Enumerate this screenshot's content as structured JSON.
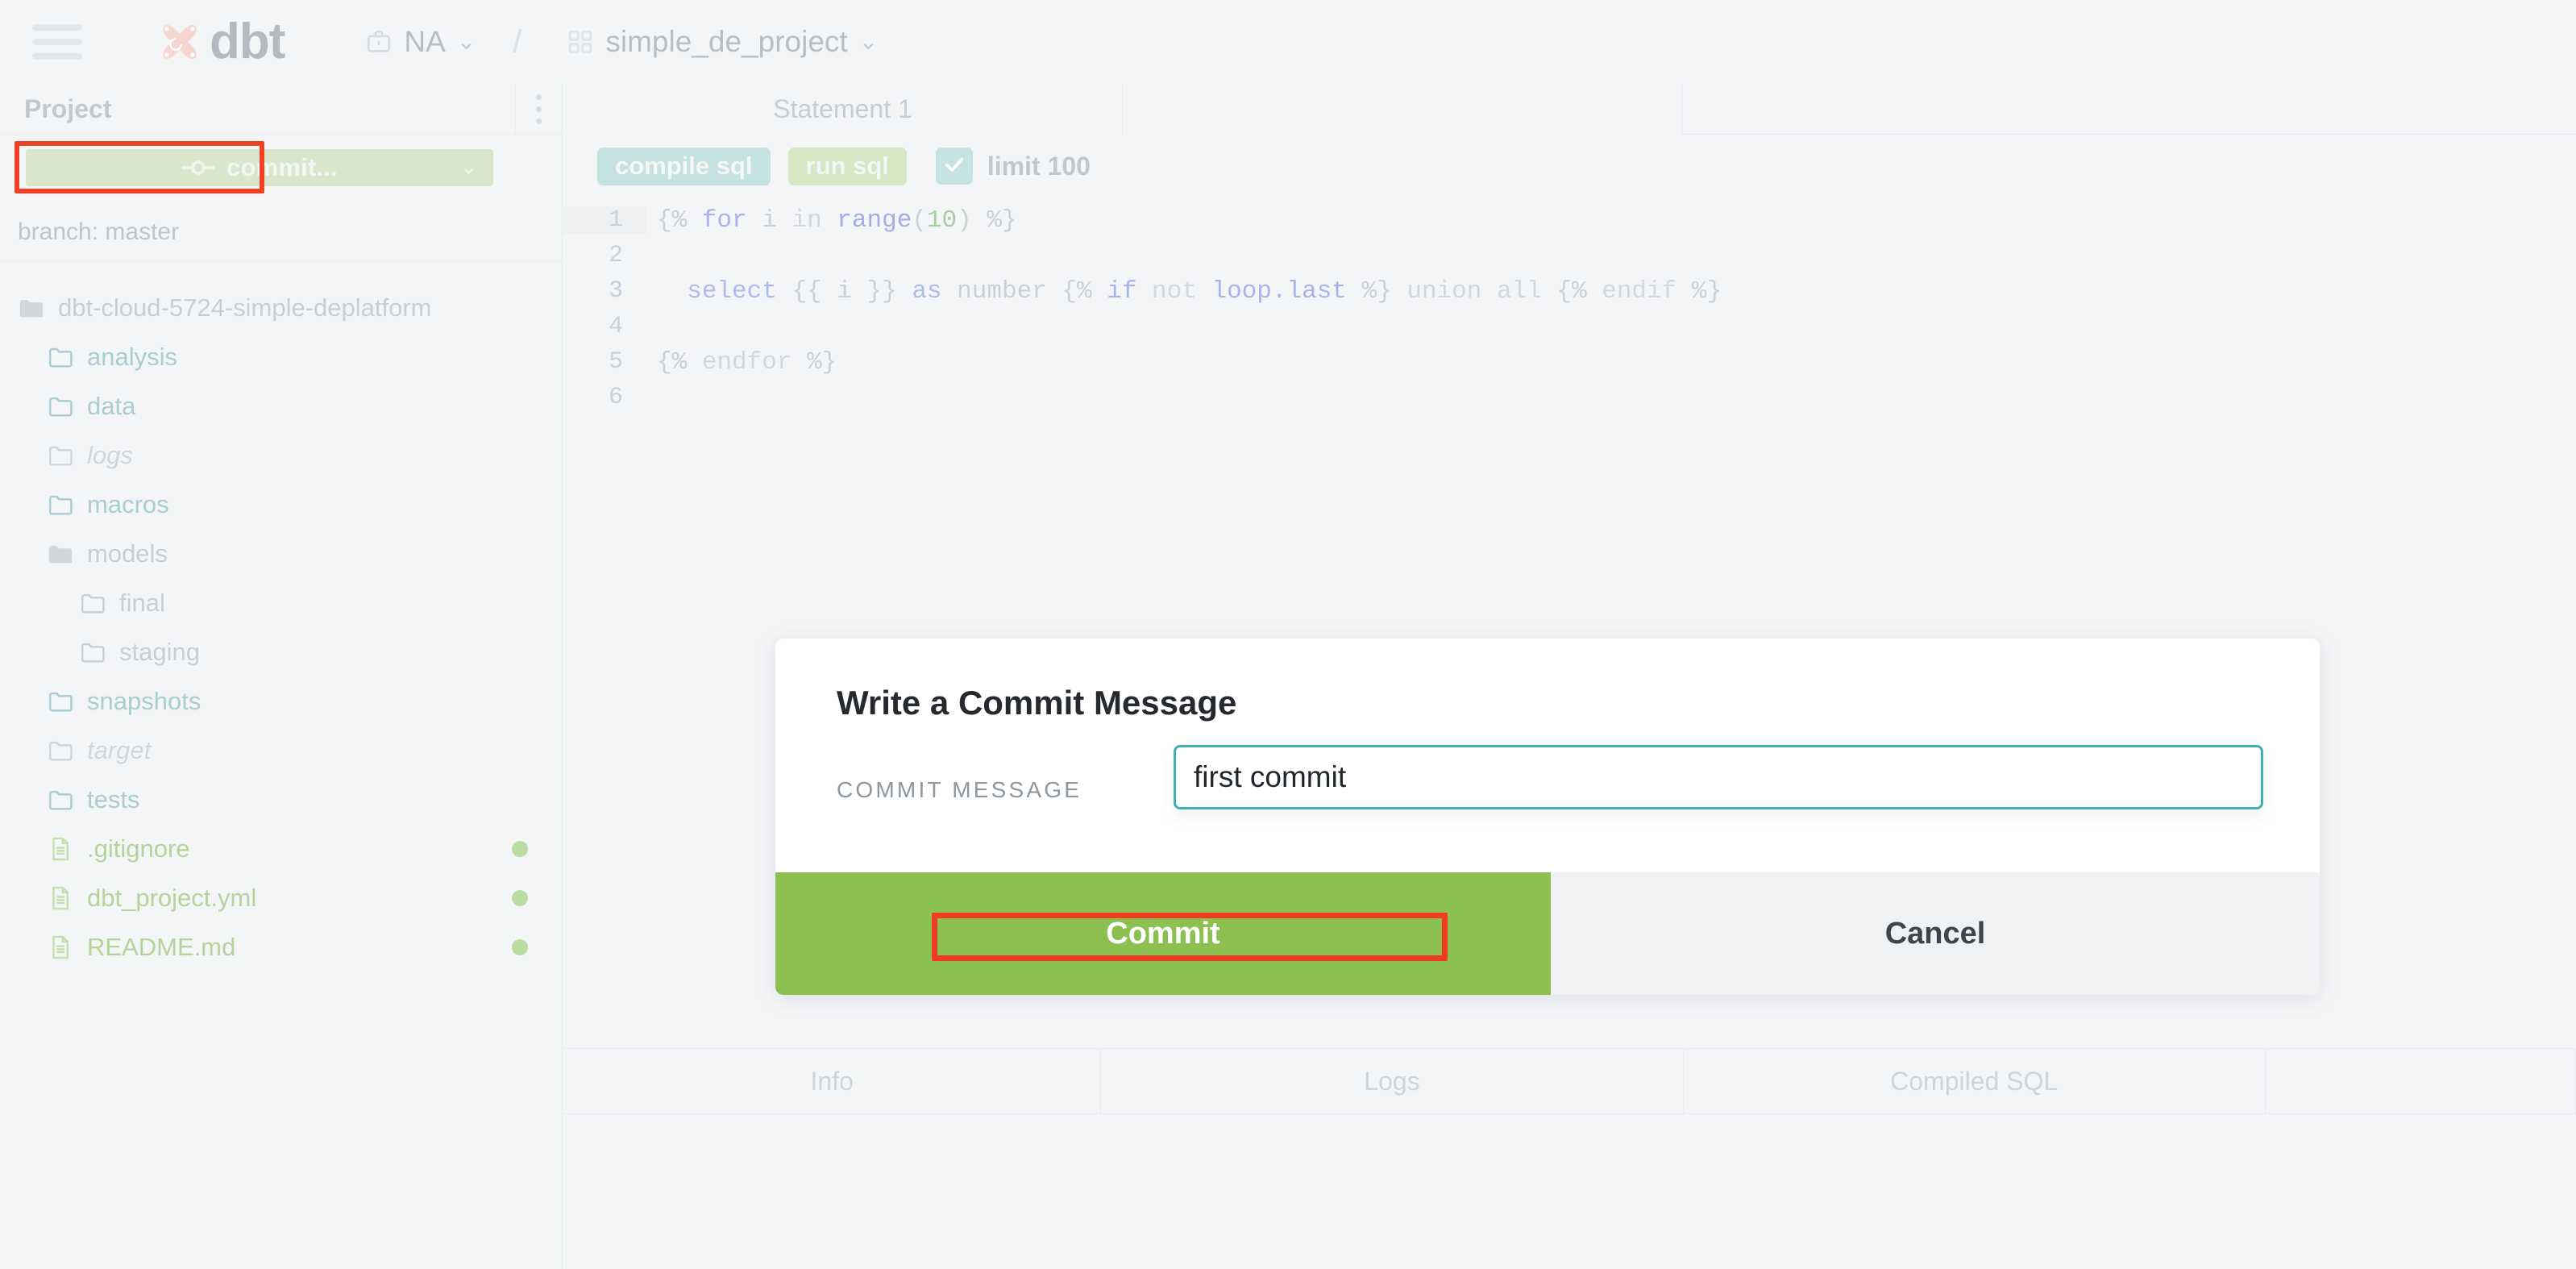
{
  "topbar": {
    "menu_icon": "hamburger-icon",
    "brand": "dbt",
    "account": "NA",
    "separator": "/",
    "project": "simple_de_project",
    "chevron": "⌄"
  },
  "sidebar": {
    "title": "Project",
    "kebab_icon": "kebab-menu-icon",
    "commit_button": {
      "label": "commit...",
      "icon": "git-commit-icon",
      "chevron": "⌄"
    },
    "branch": "branch: master",
    "tree": [
      {
        "name": "dbt-cloud-5724-simple-deplatform",
        "type": "folder-open",
        "depth": 0,
        "style": "root",
        "dot": false
      },
      {
        "name": "analysis",
        "type": "folder",
        "depth": 1,
        "style": "teal",
        "dot": false
      },
      {
        "name": "data",
        "type": "folder",
        "depth": 1,
        "style": "teal",
        "dot": false
      },
      {
        "name": "logs",
        "type": "folder",
        "depth": 1,
        "style": "gray",
        "dot": false
      },
      {
        "name": "macros",
        "type": "folder",
        "depth": 1,
        "style": "teal",
        "dot": false
      },
      {
        "name": "models",
        "type": "folder-open",
        "depth": 1,
        "style": "plain",
        "dot": false
      },
      {
        "name": "final",
        "type": "folder",
        "depth": 2,
        "style": "plain",
        "dot": false
      },
      {
        "name": "staging",
        "type": "folder",
        "depth": 2,
        "style": "plain",
        "dot": false
      },
      {
        "name": "snapshots",
        "type": "folder",
        "depth": 1,
        "style": "teal",
        "dot": false
      },
      {
        "name": "target",
        "type": "folder",
        "depth": 1,
        "style": "gray",
        "dot": false
      },
      {
        "name": "tests",
        "type": "folder",
        "depth": 1,
        "style": "teal",
        "dot": false
      },
      {
        "name": ".gitignore",
        "type": "file",
        "depth": 1,
        "style": "green",
        "dot": true
      },
      {
        "name": "dbt_project.yml",
        "type": "file",
        "depth": 1,
        "style": "green",
        "dot": true
      },
      {
        "name": "README.md",
        "type": "file",
        "depth": 1,
        "style": "green",
        "dot": true
      }
    ]
  },
  "editor": {
    "tabs": [
      {
        "label": "Statement 1"
      },
      {
        "label": ""
      }
    ],
    "toolbar": {
      "compile_label": "compile sql",
      "run_label": "run sql",
      "limit_label": "limit 100",
      "limit_checked": true,
      "check_icon": "checkmark-icon"
    },
    "code_lines": [
      {
        "n": "1",
        "active": true,
        "text": "{% for i in range(10) %}"
      },
      {
        "n": "2",
        "active": false,
        "text": ""
      },
      {
        "n": "3",
        "active": false,
        "text": "  select {{ i }} as number {% if not loop.last %} union all {% endif %}"
      },
      {
        "n": "4",
        "active": false,
        "text": ""
      },
      {
        "n": "5",
        "active": false,
        "text": "{% endfor %}"
      },
      {
        "n": "6",
        "active": false,
        "text": ""
      }
    ]
  },
  "bottom_tabs": [
    {
      "label": "Info"
    },
    {
      "label": "Logs"
    },
    {
      "label": "Compiled SQL"
    },
    {
      "label": ""
    },
    {
      "label": ""
    }
  ],
  "modal": {
    "title": "Write a Commit Message",
    "field_label": "COMMIT MESSAGE",
    "input_value": "first commit",
    "input_placeholder": "",
    "commit_label": "Commit",
    "cancel_label": "Cancel"
  },
  "colors": {
    "page_bg": "#f4f5f7",
    "annotation_red": "#ef4123",
    "commit_green": "#8cc152",
    "commit_pill_green": "#dbe7cd",
    "accent_teal": "#3fb2ad",
    "compile_teal": "#c5e2e1",
    "run_green": "#d7e6c4",
    "status_dot_green": "#bcdda2"
  }
}
